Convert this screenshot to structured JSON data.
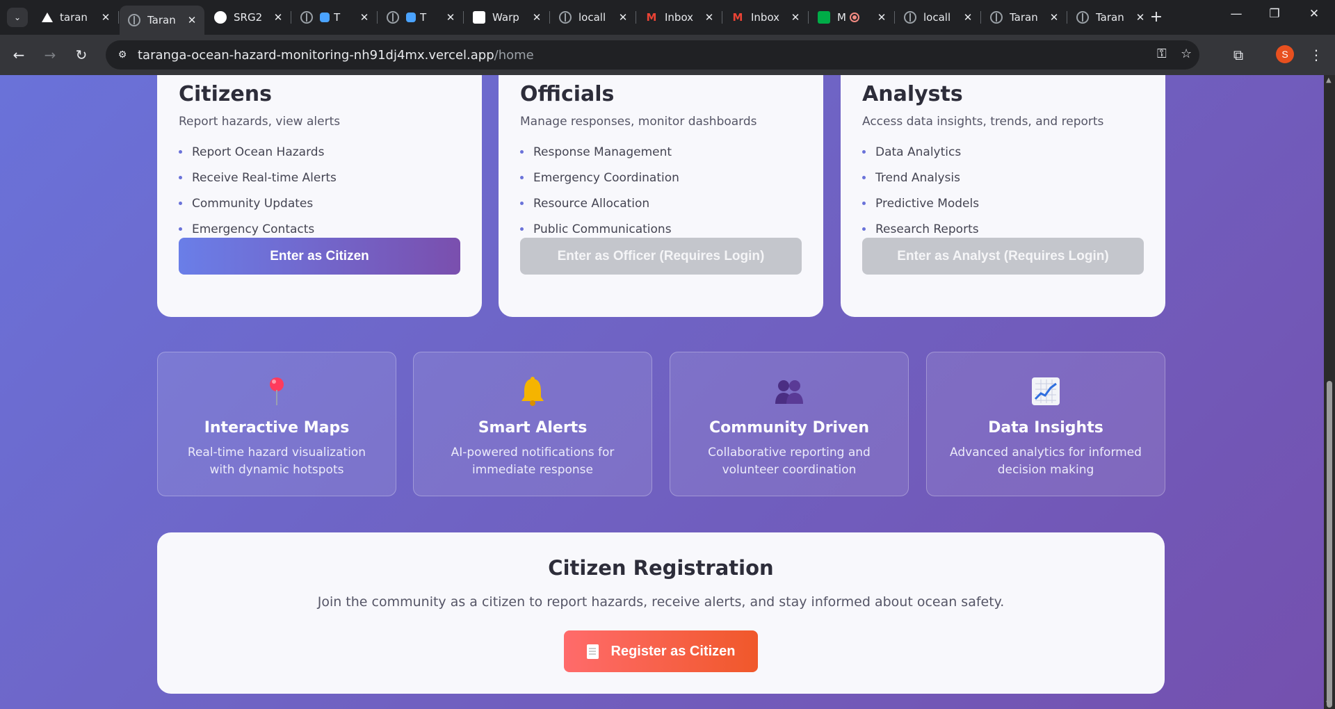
{
  "browser": {
    "tabs": [
      {
        "title": "taran",
        "icon": "vercel-icon"
      },
      {
        "title": "Taran",
        "icon": "globe-icon",
        "active": true
      },
      {
        "title": "SRG2",
        "icon": "github-icon"
      },
      {
        "title": "T",
        "icon": "globe-icon"
      },
      {
        "title": "T",
        "icon": "globe-icon"
      },
      {
        "title": "Warp",
        "icon": "warp-icon"
      },
      {
        "title": "locall",
        "icon": "globe-icon"
      },
      {
        "title": "Inbox",
        "icon": "gmail-icon"
      },
      {
        "title": "Inbox",
        "icon": "gmail-icon"
      },
      {
        "title": "M",
        "icon": "meet-icon"
      },
      {
        "title": "locall",
        "icon": "globe-icon"
      },
      {
        "title": "Taran",
        "icon": "globe-icon"
      },
      {
        "title": "Taran",
        "icon": "globe-icon"
      }
    ],
    "url_host": "taranga-ocean-hazard-monitoring-nh91dj4mx.vercel.app",
    "url_path": "/home",
    "profile_initial": "S"
  },
  "roles": [
    {
      "title": "Citizens",
      "subtitle": "Report hazards, view alerts",
      "features": [
        "Report Ocean Hazards",
        "Receive Real-time Alerts",
        "Community Updates",
        "Emergency Contacts"
      ],
      "button": "Enter as Citizen"
    },
    {
      "title": "Officials",
      "subtitle": "Manage responses, monitor dashboards",
      "features": [
        "Response Management",
        "Emergency Coordination",
        "Resource Allocation",
        "Public Communications"
      ],
      "button": "Enter as Officer (Requires Login)"
    },
    {
      "title": "Analysts",
      "subtitle": "Access data insights, trends, and reports",
      "features": [
        "Data Analytics",
        "Trend Analysis",
        "Predictive Models",
        "Research Reports"
      ],
      "button": "Enter as Analyst (Requires Login)"
    }
  ],
  "features": [
    {
      "icon": "map-pin-icon",
      "title": "Interactive Maps",
      "desc": "Real-time hazard visualization with dynamic hotspots"
    },
    {
      "icon": "bell-icon",
      "title": "Smart Alerts",
      "desc": "AI-powered notifications for immediate response"
    },
    {
      "icon": "people-icon",
      "title": "Community Driven",
      "desc": "Collaborative reporting and volunteer coordination"
    },
    {
      "icon": "chart-icon",
      "title": "Data Insights",
      "desc": "Advanced analytics for informed decision making"
    }
  ],
  "registration": {
    "title": "Citizen Registration",
    "text": "Join the community as a citizen to report hazards, receive alerts, and stay informed about ocean safety.",
    "button": "Register as Citizen"
  },
  "colors": {
    "accent": "#6a72d9",
    "register_button": "#f0582a"
  }
}
